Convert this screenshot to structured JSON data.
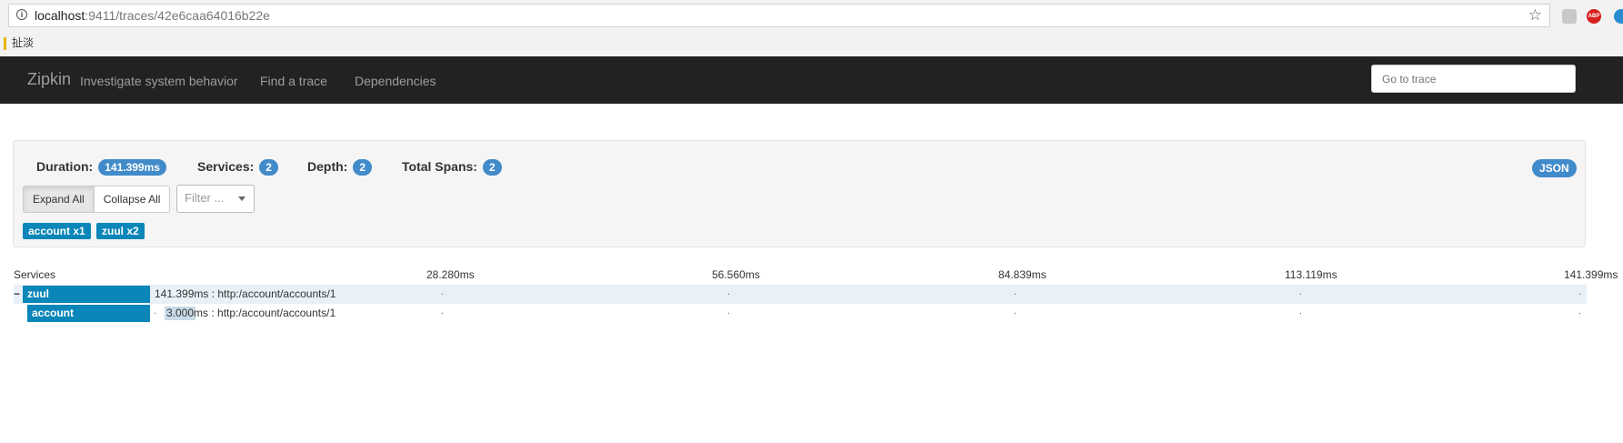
{
  "browser": {
    "url_host": "localhost",
    "url_rest": ":9411/traces/42e6caa64016b22e",
    "bookmark": "扯淡",
    "ext_abp": "ABP"
  },
  "nav": {
    "brand": "Zipkin",
    "tagline": "Investigate system behavior",
    "links": [
      "Find a trace",
      "Dependencies"
    ],
    "goto_placeholder": "Go to trace"
  },
  "summary": {
    "duration_label": "Duration:",
    "duration_value": "141.399ms",
    "services_label": "Services:",
    "services_value": "2",
    "depth_label": "Depth:",
    "depth_value": "2",
    "spans_label": "Total Spans:",
    "spans_value": "2",
    "json_label": "JSON",
    "expand_all": "Expand All",
    "collapse_all": "Collapse All",
    "filter_placeholder": "Filter ...",
    "service_tags": [
      "account x1",
      "zuul x2"
    ]
  },
  "timeline": {
    "services_header": "Services",
    "ticks": [
      "28.280ms",
      "56.560ms",
      "84.839ms",
      "113.119ms",
      "141.399ms"
    ],
    "rows": [
      {
        "toggle": "−",
        "service": "zuul",
        "label": "141.399ms : http:/account/accounts/1"
      },
      {
        "toggle": "",
        "service": "account",
        "label": "3.000ms : http:/account/accounts/1"
      }
    ]
  },
  "colors": {
    "navbar": "#222222",
    "badge": "#428bca",
    "service_tag": "#0a86b8"
  }
}
